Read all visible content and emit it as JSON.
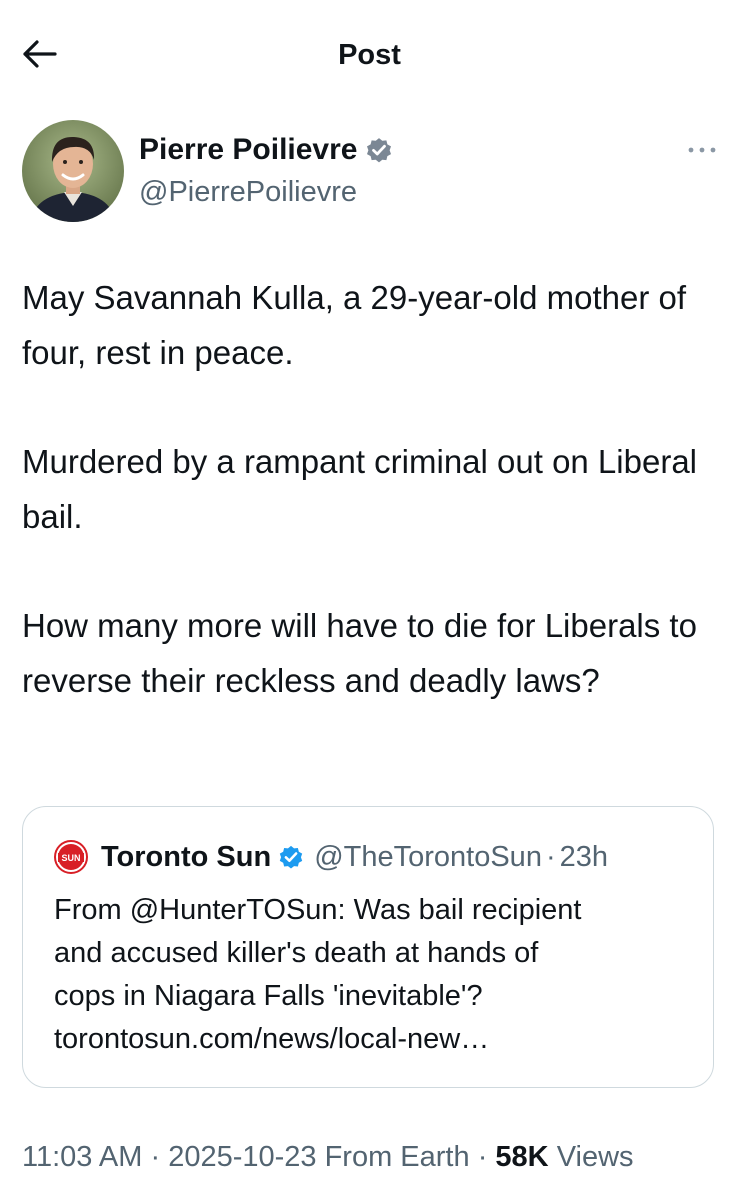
{
  "header": {
    "title": "Post"
  },
  "author": {
    "name": "Pierre Poilievre",
    "handle": "@PierrePoilievre",
    "verified": true
  },
  "tweet": {
    "paragraphs": [
      "May Savannah Kulla, a 29-year-old mother of four, rest in peace.",
      "Murdered by a rampant criminal out on Liberal bail.",
      "How many more will have to die for Liberals to reverse their reckless and deadly laws?"
    ]
  },
  "quote": {
    "logo_text": "SUN",
    "name": "Toronto Sun",
    "verified": true,
    "handle": "@TheTorontoSun",
    "separator": "·",
    "time": "23h",
    "lines": [
      "From @HunterTOSun: Was bail recipient",
      "and accused killer's death at hands of",
      "cops in Niagara Falls 'inevitable'?",
      "torontosun.com/news/local-new…"
    ]
  },
  "meta": {
    "time": "11:03 AM",
    "separator": "·",
    "date": "2025-10-23",
    "source": "From Earth",
    "views_count": "58K",
    "views_label": "Views"
  },
  "colors": {
    "text": "#0f1419",
    "secondary": "#536471",
    "verified_blue": "#1d9bf0",
    "border": "#cfd9de",
    "sun_red": "#d81f26"
  },
  "icons": {
    "back": "arrow-left-icon",
    "verified": "verified-badge-icon",
    "more": "more-dots-icon",
    "sun_logo": "toronto-sun-logo"
  }
}
